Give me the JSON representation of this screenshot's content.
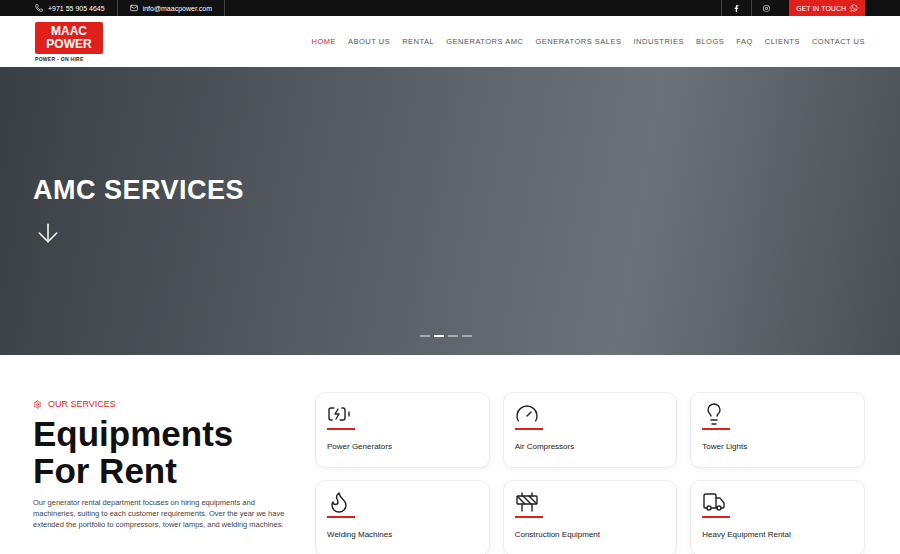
{
  "top_bar": {
    "phone": "+971 55 905 4645",
    "email": "info@maacpower.com",
    "button": "GET IN TOUCH"
  },
  "logo": {
    "line1": "MAAC",
    "line2": "POWER",
    "tagline": "POWER - ON HIRE"
  },
  "nav": [
    {
      "label": "HOME",
      "selected": true
    },
    {
      "label": "ABOUT US",
      "selected": false
    },
    {
      "label": "RENTAL",
      "selected": false
    },
    {
      "label": "GENERATORS AMC",
      "selected": false
    },
    {
      "label": "GENERATORS SALES",
      "selected": false
    },
    {
      "label": "INDUSTRIES",
      "selected": false
    },
    {
      "label": "BLOGS",
      "selected": false
    },
    {
      "label": "FAQ",
      "selected": false
    },
    {
      "label": "CLIENTS",
      "selected": false
    },
    {
      "label": "CONTACT US",
      "selected": false
    }
  ],
  "hero": {
    "title": "AMC SERVICES",
    "slides": [
      {
        "selected": false
      },
      {
        "selected": true
      },
      {
        "selected": false
      },
      {
        "selected": false
      }
    ]
  },
  "services": {
    "eyebrow": "OUR SERVICES",
    "title_lines": [
      "Equipments",
      "For Rent"
    ],
    "description": "Our generator rental department focuses on hiring equipments and machineries, suiting to each customer requirements. Over the year we have extended the portfolio to compressors, tower lamps, and welding machines.",
    "cards": [
      {
        "label": "Power Generators",
        "kind": "generator"
      },
      {
        "label": "Air Compressors",
        "kind": "compressor"
      },
      {
        "label": "Tower Lights",
        "kind": "tower"
      },
      {
        "label": "Welding Machines",
        "kind": "welding"
      },
      {
        "label": "Construction Equipment",
        "kind": "construction"
      },
      {
        "label": "Heavy Equipment Rental",
        "kind": "heavy"
      }
    ]
  }
}
